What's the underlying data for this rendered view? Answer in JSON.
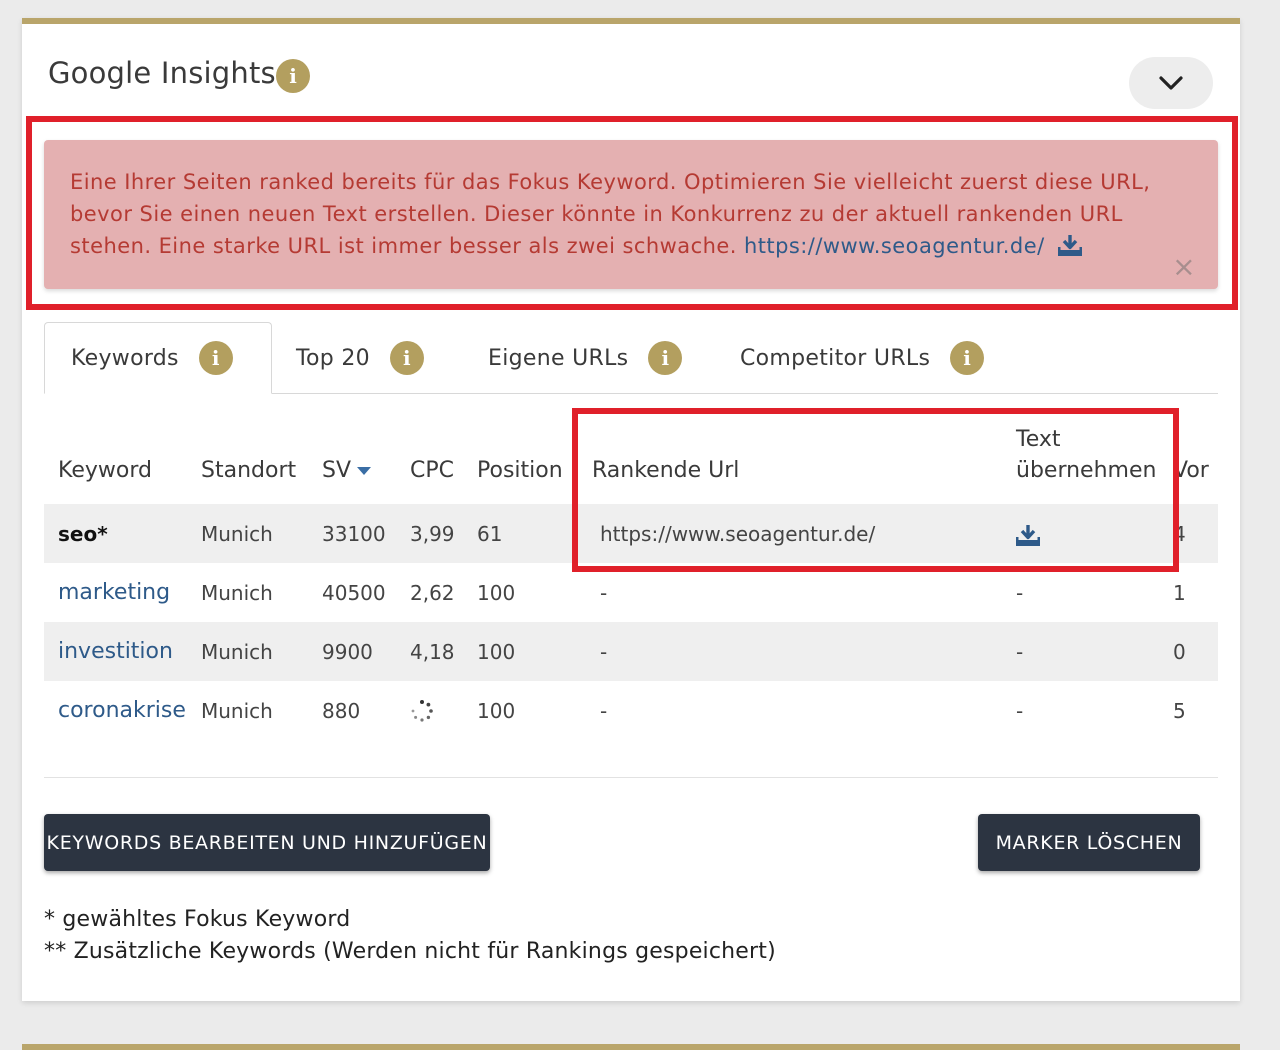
{
  "header": {
    "title": "Google Insights",
    "info_icon": "i"
  },
  "alert": {
    "message": "Eine Ihrer Seiten ranked bereits für das Fokus Keyword. Optimieren Sie vielleicht zuerst diese URL, bevor Sie einen neuen Text erstellen. Dieser könnte in Konkurrenz zu der aktuell rankenden URL stehen. Eine starke URL ist immer besser als zwei schwache.",
    "link": "https://www.seoagentur.de/",
    "close": "×"
  },
  "tabs": [
    {
      "label": "Keywords",
      "active": true
    },
    {
      "label": "Top 20",
      "active": false
    },
    {
      "label": "Eigene URLs",
      "active": false
    },
    {
      "label": "Competitor URLs",
      "active": false
    }
  ],
  "table": {
    "columns": [
      "Keyword",
      "Standort",
      "SV",
      "CPC",
      "Position",
      "Rankende Url",
      "Text übernehmen",
      "Vor"
    ],
    "rows": [
      {
        "keyword": "seo*",
        "standort": "Munich",
        "sv": "33100",
        "cpc": "3,99",
        "position": "61",
        "url": "https://www.seoagentur.de/",
        "text": "",
        "vor": "4"
      },
      {
        "keyword": "marketing",
        "standort": "Munich",
        "sv": "40500",
        "cpc": "2,62",
        "position": "100",
        "url": "-",
        "text": "-",
        "vor": "1"
      },
      {
        "keyword": "investition",
        "standort": "Munich",
        "sv": "9900",
        "cpc": "4,18",
        "position": "100",
        "url": "-",
        "text": "-",
        "vor": "0"
      },
      {
        "keyword": "coronakrise",
        "standort": "Munich",
        "sv": "880",
        "cpc": "",
        "position": "100",
        "url": "-",
        "text": "-",
        "vor": "5"
      }
    ]
  },
  "buttons": {
    "edit_keywords": "KEYWORDS BEARBEITEN UND HINZUFÜGEN",
    "clear_markers": "MARKER LÖSCHEN"
  },
  "footnotes": {
    "line1": "* gewähltes Fokus Keyword",
    "line2": "** Zusätzliche Keywords (Werden nicht für Rankings gespeichert)"
  },
  "colors": {
    "accent_gold": "#b39f5f",
    "alert_bg": "#e4b0b1",
    "alert_text": "#b53a33",
    "link_blue": "#2e5a89",
    "button_bg": "#2c3441",
    "highlight_red": "#e0202a"
  }
}
